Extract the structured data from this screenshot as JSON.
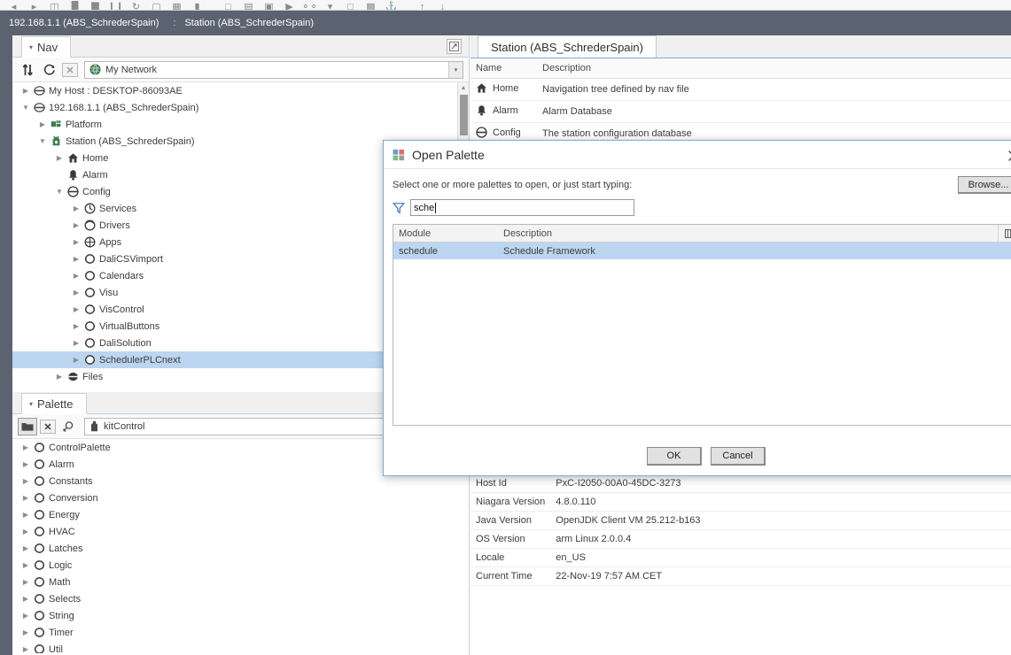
{
  "toolbar": {
    "icons": [
      "back-icon",
      "forward-icon",
      "folder-open-icon",
      "save-icon",
      "save-all-icon",
      "pause-icon",
      "refresh-icon",
      "history-icon",
      "export-icon",
      "print-icon",
      "window-icon",
      "table-icon",
      "chart-icon",
      "link-icon",
      "binoculars-icon",
      "shield-icon",
      "square-icon",
      "duplicate-icon",
      "anchor-icon",
      "up-icon",
      "down-icon"
    ]
  },
  "breadcrumb": {
    "host": "192.168.1.1 (ABS_SchrederSpain)",
    "separator": ":",
    "station": "Station (ABS_SchrederSpain)"
  },
  "nav": {
    "tab_label": "Nav",
    "caret": "▾",
    "expand_icon": "maximize-icon",
    "toolbar": {
      "sort_icon": "sort-arrows-icon",
      "refresh_icon": "refresh-icon",
      "close_icon": "close-box-icon",
      "network_icon": "globe-icon",
      "selected": "My Network",
      "dropdown_arrow": "▾"
    },
    "tree": [
      {
        "label": "My Host : DESKTOP-86093AE",
        "indent": 0,
        "twisty": "collapsed",
        "icon": "host-icon",
        "selected": false
      },
      {
        "label": "192.168.1.1 (ABS_SchrederSpain)",
        "indent": 0,
        "twisty": "expanded",
        "icon": "host-icon",
        "selected": false
      },
      {
        "label": "Platform",
        "indent": 1,
        "twisty": "collapsed",
        "icon": "platform-icon",
        "selected": false
      },
      {
        "label": "Station (ABS_SchrederSpain)",
        "indent": 1,
        "twisty": "expanded",
        "icon": "station-icon",
        "selected": false
      },
      {
        "label": "Home",
        "indent": 2,
        "twisty": "collapsed",
        "icon": "home-icon",
        "selected": false
      },
      {
        "label": "Alarm",
        "indent": 2,
        "twisty": "none",
        "icon": "bell-icon",
        "selected": false
      },
      {
        "label": "Config",
        "indent": 2,
        "twisty": "expanded",
        "icon": "config-icon",
        "selected": false
      },
      {
        "label": "Services",
        "indent": 3,
        "twisty": "collapsed",
        "icon": "services-icon",
        "selected": false
      },
      {
        "label": "Drivers",
        "indent": 3,
        "twisty": "collapsed",
        "icon": "drivers-icon",
        "selected": false
      },
      {
        "label": "Apps",
        "indent": 3,
        "twisty": "collapsed",
        "icon": "apps-icon",
        "selected": false
      },
      {
        "label": "DaliCSVimport",
        "indent": 3,
        "twisty": "collapsed",
        "icon": "folder-node-icon",
        "selected": false
      },
      {
        "label": "Calendars",
        "indent": 3,
        "twisty": "collapsed",
        "icon": "folder-node-icon",
        "selected": false
      },
      {
        "label": "Visu",
        "indent": 3,
        "twisty": "collapsed",
        "icon": "folder-node-icon",
        "selected": false
      },
      {
        "label": "VisControl",
        "indent": 3,
        "twisty": "collapsed",
        "icon": "folder-node-icon",
        "selected": false
      },
      {
        "label": "VirtualButtons",
        "indent": 3,
        "twisty": "collapsed",
        "icon": "folder-node-icon",
        "selected": false
      },
      {
        "label": "DaliSolution",
        "indent": 3,
        "twisty": "collapsed",
        "icon": "folder-node-icon",
        "selected": false
      },
      {
        "label": "SchedulerPLCnext",
        "indent": 3,
        "twisty": "collapsed",
        "icon": "folder-node-icon",
        "selected": true
      },
      {
        "label": "Files",
        "indent": 2,
        "twisty": "collapsed",
        "icon": "files-icon",
        "selected": false
      }
    ]
  },
  "palette": {
    "tab_label": "Palette",
    "caret": "▾",
    "toolbar": {
      "open_icon": "folder-icon",
      "close_icon": "close-box-icon",
      "search_icon": "search-back-icon",
      "module_icon": "module-icon",
      "selected": "kitControl"
    },
    "items": [
      {
        "label": "ControlPalette"
      },
      {
        "label": "Alarm"
      },
      {
        "label": "Constants"
      },
      {
        "label": "Conversion"
      },
      {
        "label": "Energy"
      },
      {
        "label": "HVAC"
      },
      {
        "label": "Latches"
      },
      {
        "label": "Logic"
      },
      {
        "label": "Math"
      },
      {
        "label": "Selects"
      },
      {
        "label": "String"
      },
      {
        "label": "Timer"
      },
      {
        "label": "Util"
      }
    ]
  },
  "station_view": {
    "tab_label": "Station (ABS_SchrederSpain)",
    "columns": [
      "Name",
      "Description"
    ],
    "rows": [
      {
        "icon": "home-icon",
        "name": "Home",
        "description": "Navigation tree defined by nav file"
      },
      {
        "icon": "bell-icon",
        "name": "Alarm",
        "description": "Alarm Database"
      },
      {
        "icon": "config-icon",
        "name": "Config",
        "description": "The station configuration database"
      }
    ]
  },
  "properties": {
    "rows": [
      {
        "label": "Host Id",
        "value": "PxC-I2050-00A0-45DC-3273"
      },
      {
        "label": "Niagara Version",
        "value": "4.8.0.110"
      },
      {
        "label": "Java Version",
        "value": "OpenJDK Client VM 25.212-b163"
      },
      {
        "label": "OS Version",
        "value": "arm Linux 2.0.0.4"
      },
      {
        "label": "Locale",
        "value": "en_US"
      },
      {
        "label": "Current Time",
        "value": "22-Nov-19 7:57 AM CET"
      }
    ]
  },
  "dialog": {
    "title": "Open Palette",
    "title_icon": "palette-icon",
    "close_icon": "close-icon",
    "prompt": "Select one or more palettes to open, or just start typing:",
    "browse_label": "Browse...",
    "filter": {
      "icon": "filter-icon",
      "value": "sche",
      "placeholder": ""
    },
    "columns": [
      "Module",
      "Description"
    ],
    "column_settings_icon": "column-settings-icon",
    "rows": [
      {
        "module": "schedule",
        "description": "Schedule Framework",
        "selected": true
      }
    ],
    "ok_label": "OK",
    "cancel_label": "Cancel"
  },
  "colors": {
    "breadcrumb_bg": "#5b6270",
    "selection": "#bcd5f0",
    "tab_underline": "#7fa9d0",
    "dialog_border": "#7aadd6",
    "tree_icon_green": "#3f7d4e",
    "tree_icon_gray": "#5a5a5a"
  }
}
